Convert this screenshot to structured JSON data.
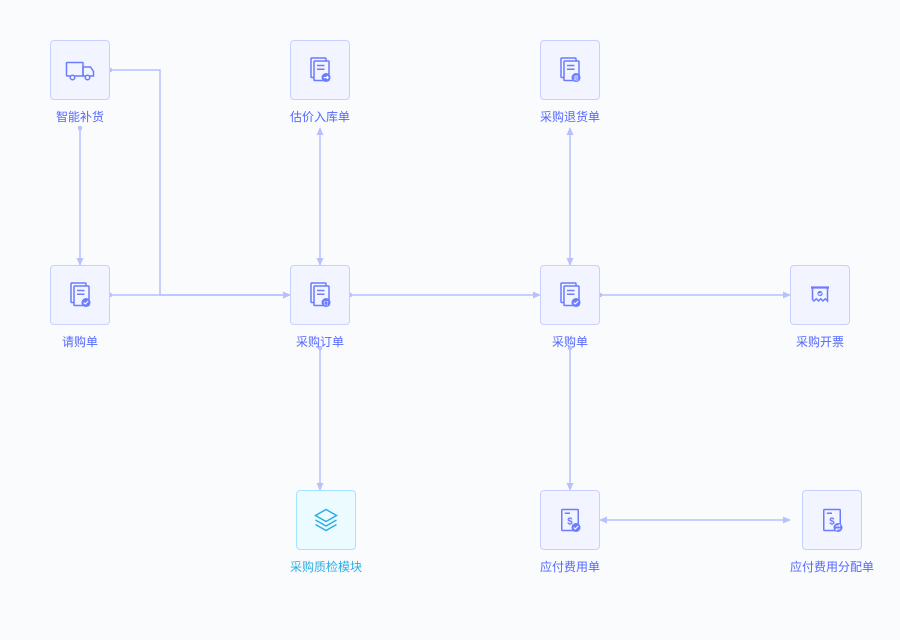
{
  "nodes": {
    "smart_replenish": {
      "label": "智能补货",
      "icon": "truck"
    },
    "purchase_request": {
      "label": "请购单",
      "icon": "doc-check"
    },
    "est_inbound": {
      "label": "估价入库单",
      "icon": "doc-arrow"
    },
    "purchase_order": {
      "label": "采购订单",
      "icon": "doc-badge"
    },
    "qc_module": {
      "label": "采购质检模块",
      "icon": "stack",
      "alt": true
    },
    "purchase_return": {
      "label": "采购退货单",
      "icon": "doc-return"
    },
    "purchase_doc": {
      "label": "采购单",
      "icon": "doc-check"
    },
    "ap_expense": {
      "label": "应付费用单",
      "icon": "doc-money-check"
    },
    "invoice": {
      "label": "采购开票",
      "icon": "receipt"
    },
    "ap_expense_alloc": {
      "label": "应付费用分配单",
      "icon": "doc-money-swap"
    }
  },
  "flow": {
    "edges": [
      [
        "smart_replenish",
        "purchase_order"
      ],
      [
        "smart_replenish",
        "purchase_request"
      ],
      [
        "purchase_request",
        "purchase_order"
      ],
      [
        "purchase_order",
        "est_inbound",
        "bidir"
      ],
      [
        "purchase_order",
        "qc_module"
      ],
      [
        "purchase_order",
        "purchase_doc"
      ],
      [
        "purchase_doc",
        "purchase_return",
        "bidir"
      ],
      [
        "purchase_doc",
        "invoice"
      ],
      [
        "purchase_doc",
        "ap_expense"
      ],
      [
        "ap_expense",
        "ap_expense_alloc",
        "bidir"
      ]
    ]
  },
  "colors": {
    "primary": "#5468ff",
    "primary_bg": "#f2f4ff",
    "primary_border": "#c9d0ff",
    "alt": "#2baee6",
    "alt_bg": "#ecfbff",
    "alt_border": "#a6e3ff",
    "arrow": "#b8c0ff"
  }
}
